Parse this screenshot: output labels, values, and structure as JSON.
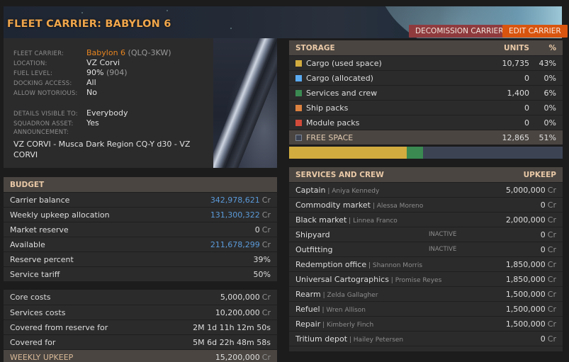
{
  "header": {
    "title": "FLEET CARRIER: BABYLON 6",
    "buttons": {
      "decommission": "DECOMISSION CARRIER",
      "edit": "EDIT CARRIER"
    }
  },
  "info": {
    "fields": [
      {
        "label": "FLEET CARRIER:",
        "value": "Babylon 6",
        "extra": "(QLQ-3KW)"
      },
      {
        "label": "LOCATION:",
        "value": "VZ Corvi"
      },
      {
        "label": "FUEL LEVEL:",
        "value": "90%",
        "extra": "(904)"
      },
      {
        "label": "DOCKING ACCESS:",
        "value": "All"
      },
      {
        "label": "ALLOW NOTORIOUS:",
        "value": "No"
      },
      {
        "label": "DETAILS VISIBLE TO:",
        "value": "Everybody"
      },
      {
        "label": "SQUADRON ASSET:",
        "value": "Yes"
      },
      {
        "label": "ANNOUNCEMENT:"
      }
    ],
    "announcement": "VZ CORVI - Musca Dark Region CQ-Y d30 - VZ CORVI"
  },
  "budget": {
    "title": "BUDGET",
    "currency": "Cr",
    "rows": [
      {
        "label": "Carrier balance",
        "value": "342,978,621",
        "cr": true,
        "blue": true
      },
      {
        "label": "Weekly upkeep allocation",
        "value": "131,300,322",
        "cr": true,
        "blue": true
      },
      {
        "label": "Market reserve",
        "value": "0",
        "cr": true
      },
      {
        "label": "Available",
        "value": "211,678,299",
        "cr": true,
        "blue": true
      },
      {
        "label": "Reserve percent",
        "value": "39%"
      },
      {
        "label": "Service tariff",
        "value": "50%"
      }
    ]
  },
  "costs": {
    "rows": [
      {
        "label": "Core costs",
        "value": "5,000,000",
        "cr": true
      },
      {
        "label": "Services costs",
        "value": "10,200,000",
        "cr": true
      },
      {
        "label": "Covered from reserve for",
        "value": "2M 1d 11h 12m 50s"
      },
      {
        "label": "Covered for",
        "value": "5M 6d 22h 48m 58s"
      }
    ],
    "total": {
      "label": "WEEKLY UPKEEP",
      "value": "15,200,000",
      "cr": true
    }
  },
  "storage": {
    "title": "STORAGE",
    "col_units": "UNITS",
    "col_pct": "%",
    "rows": [
      {
        "label": "Cargo (used space)",
        "units": "10,735",
        "pct": "43%",
        "color": "#d2ac3f",
        "fraction": 0.43
      },
      {
        "label": "Cargo (allocated)",
        "units": "0",
        "pct": "0%",
        "color": "#5aaaf0",
        "fraction": 0
      },
      {
        "label": "Services and crew",
        "units": "1,400",
        "pct": "6%",
        "color": "#3a8a52",
        "fraction": 0.06
      },
      {
        "label": "Ship packs",
        "units": "0",
        "pct": "0%",
        "color": "#dc8240",
        "fraction": 0
      },
      {
        "label": "Module packs",
        "units": "0",
        "pct": "0%",
        "color": "#d24a3a",
        "fraction": 0
      }
    ],
    "free": {
      "label": "FREE SPACE",
      "units": "12,865",
      "pct": "51%",
      "color": "#3c4454",
      "fraction": 0.51
    }
  },
  "services": {
    "title": "SERVICES AND CREW",
    "col_upkeep": "UPKEEP",
    "rows": [
      {
        "label": "Captain",
        "person": "Aniya Kennedy",
        "value": "5,000,000"
      },
      {
        "label": "Commodity market",
        "person": "Alessa Moreno",
        "value": "0"
      },
      {
        "label": "Black market",
        "person": "Linnea Franco",
        "value": "2,000,000"
      },
      {
        "label": "Shipyard",
        "status": "INACTIVE",
        "value": "0"
      },
      {
        "label": "Outfitting",
        "status": "INACTIVE",
        "value": "0"
      },
      {
        "label": "Redemption office",
        "person": "Shannon Morris",
        "value": "1,850,000"
      },
      {
        "label": "Universal Cartographics",
        "person": "Promise Reyes",
        "value": "1,850,000"
      },
      {
        "label": "Rearm",
        "person": "Zelda Gallagher",
        "value": "1,500,000"
      },
      {
        "label": "Refuel",
        "person": "Wren Allison",
        "value": "1,500,000"
      },
      {
        "label": "Repair",
        "person": "Kimberly Finch",
        "value": "1,500,000"
      },
      {
        "label": "Tritium depot",
        "person": "Hailey Petersen",
        "value": "0"
      }
    ]
  }
}
